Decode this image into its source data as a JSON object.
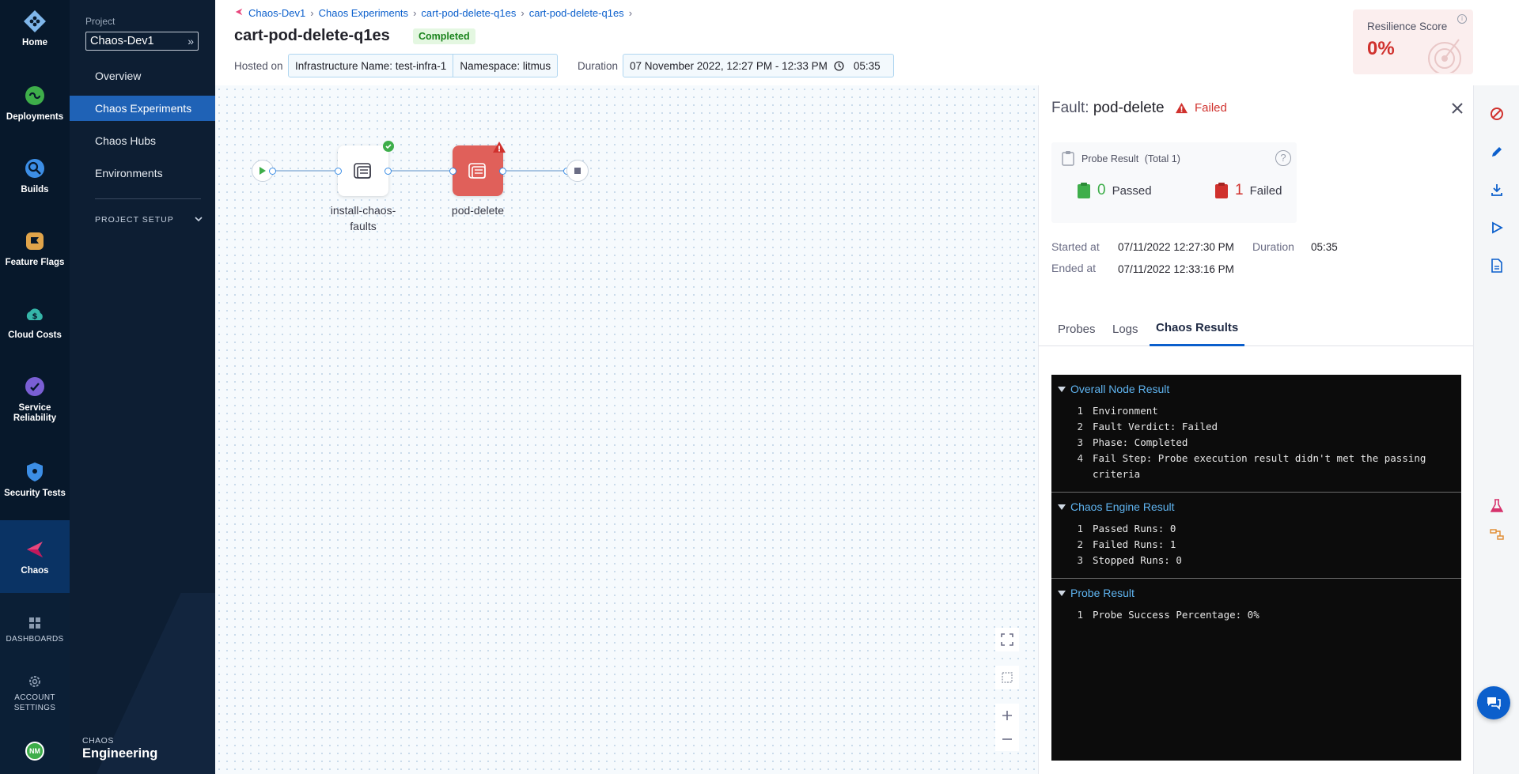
{
  "rail": {
    "items": [
      {
        "label": "Home"
      },
      {
        "label": "Deployments"
      },
      {
        "label": "Builds"
      },
      {
        "label": "Feature Flags"
      },
      {
        "label": "Cloud Costs"
      },
      {
        "label": "Service Reliability"
      },
      {
        "label": "Security Tests"
      },
      {
        "label": "Chaos"
      }
    ],
    "dashboards": "DASHBOARDS",
    "account_settings": "ACCOUNT SETTINGS",
    "avatar_initials": "NM"
  },
  "subnav": {
    "project_label": "Project",
    "project_value": "Chaos-Dev1",
    "links": [
      {
        "label": "Overview"
      },
      {
        "label": "Chaos Experiments"
      },
      {
        "label": "Chaos Hubs"
      },
      {
        "label": "Environments"
      }
    ],
    "project_setup": "PROJECT SETUP",
    "brand_small": "CHAOS",
    "brand_big": "Engineering"
  },
  "header": {
    "breadcrumbs": [
      "Chaos-Dev1",
      "Chaos Experiments",
      "cart-pod-delete-q1es",
      "cart-pod-delete-q1es"
    ],
    "title": "cart-pod-delete-q1es",
    "status": "Completed",
    "hosted_on_label": "Hosted on",
    "infrastructure": "Infrastructure Name: test-infra-1",
    "namespace": "Namespace: litmus",
    "duration_label": "Duration",
    "duration_range": "07 November 2022, 12:27 PM - 12:33 PM",
    "duration_value": "05:35",
    "resilience_label": "Resilience Score",
    "resilience_value": "0%"
  },
  "canvas": {
    "nodes": [
      {
        "label_line1": "install-chaos-",
        "label_line2": "faults",
        "status": "success"
      },
      {
        "label_line1": "pod-delete",
        "status": "failed"
      }
    ]
  },
  "panel": {
    "fault_prefix": "Fault:",
    "fault_name": "pod-delete",
    "fault_status": "Failed",
    "probe_result_label": "Probe Result",
    "probe_total": "(Total 1)",
    "passed_count": "0",
    "passed_label": "Passed",
    "failed_count": "1",
    "failed_label": "Failed",
    "started_label": "Started at",
    "started_value": "07/11/2022 12:27:30 PM",
    "duration_label": "Duration",
    "duration_value": "05:35",
    "ended_label": "Ended at",
    "ended_value": "07/11/2022 12:33:16 PM",
    "tabs": [
      "Probes",
      "Logs",
      "Chaos Results"
    ],
    "active_tab": "Chaos Results",
    "results": [
      {
        "title": "Overall Node Result",
        "lines": [
          {
            "n": "1",
            "text": "Environment"
          },
          {
            "n": "2",
            "text": "Fault Verdict: Failed"
          },
          {
            "n": "3",
            "text": "Phase: Completed"
          },
          {
            "n": "4",
            "text": "Fail Step: Probe execution result didn't met the passing criteria"
          }
        ]
      },
      {
        "title": "Chaos Engine Result",
        "lines": [
          {
            "n": "1",
            "text": "Passed Runs: 0"
          },
          {
            "n": "2",
            "text": "Failed Runs: 1"
          },
          {
            "n": "3",
            "text": "Stopped Runs: 0"
          }
        ]
      },
      {
        "title": "Probe Result",
        "lines": [
          {
            "n": "1",
            "text": "Probe Success Percentage: 0%"
          }
        ]
      }
    ]
  },
  "colors": {
    "accent": "#0b5fcc",
    "failed": "#d0312d",
    "success": "#1b841d",
    "rail_bg": "#07182b"
  }
}
